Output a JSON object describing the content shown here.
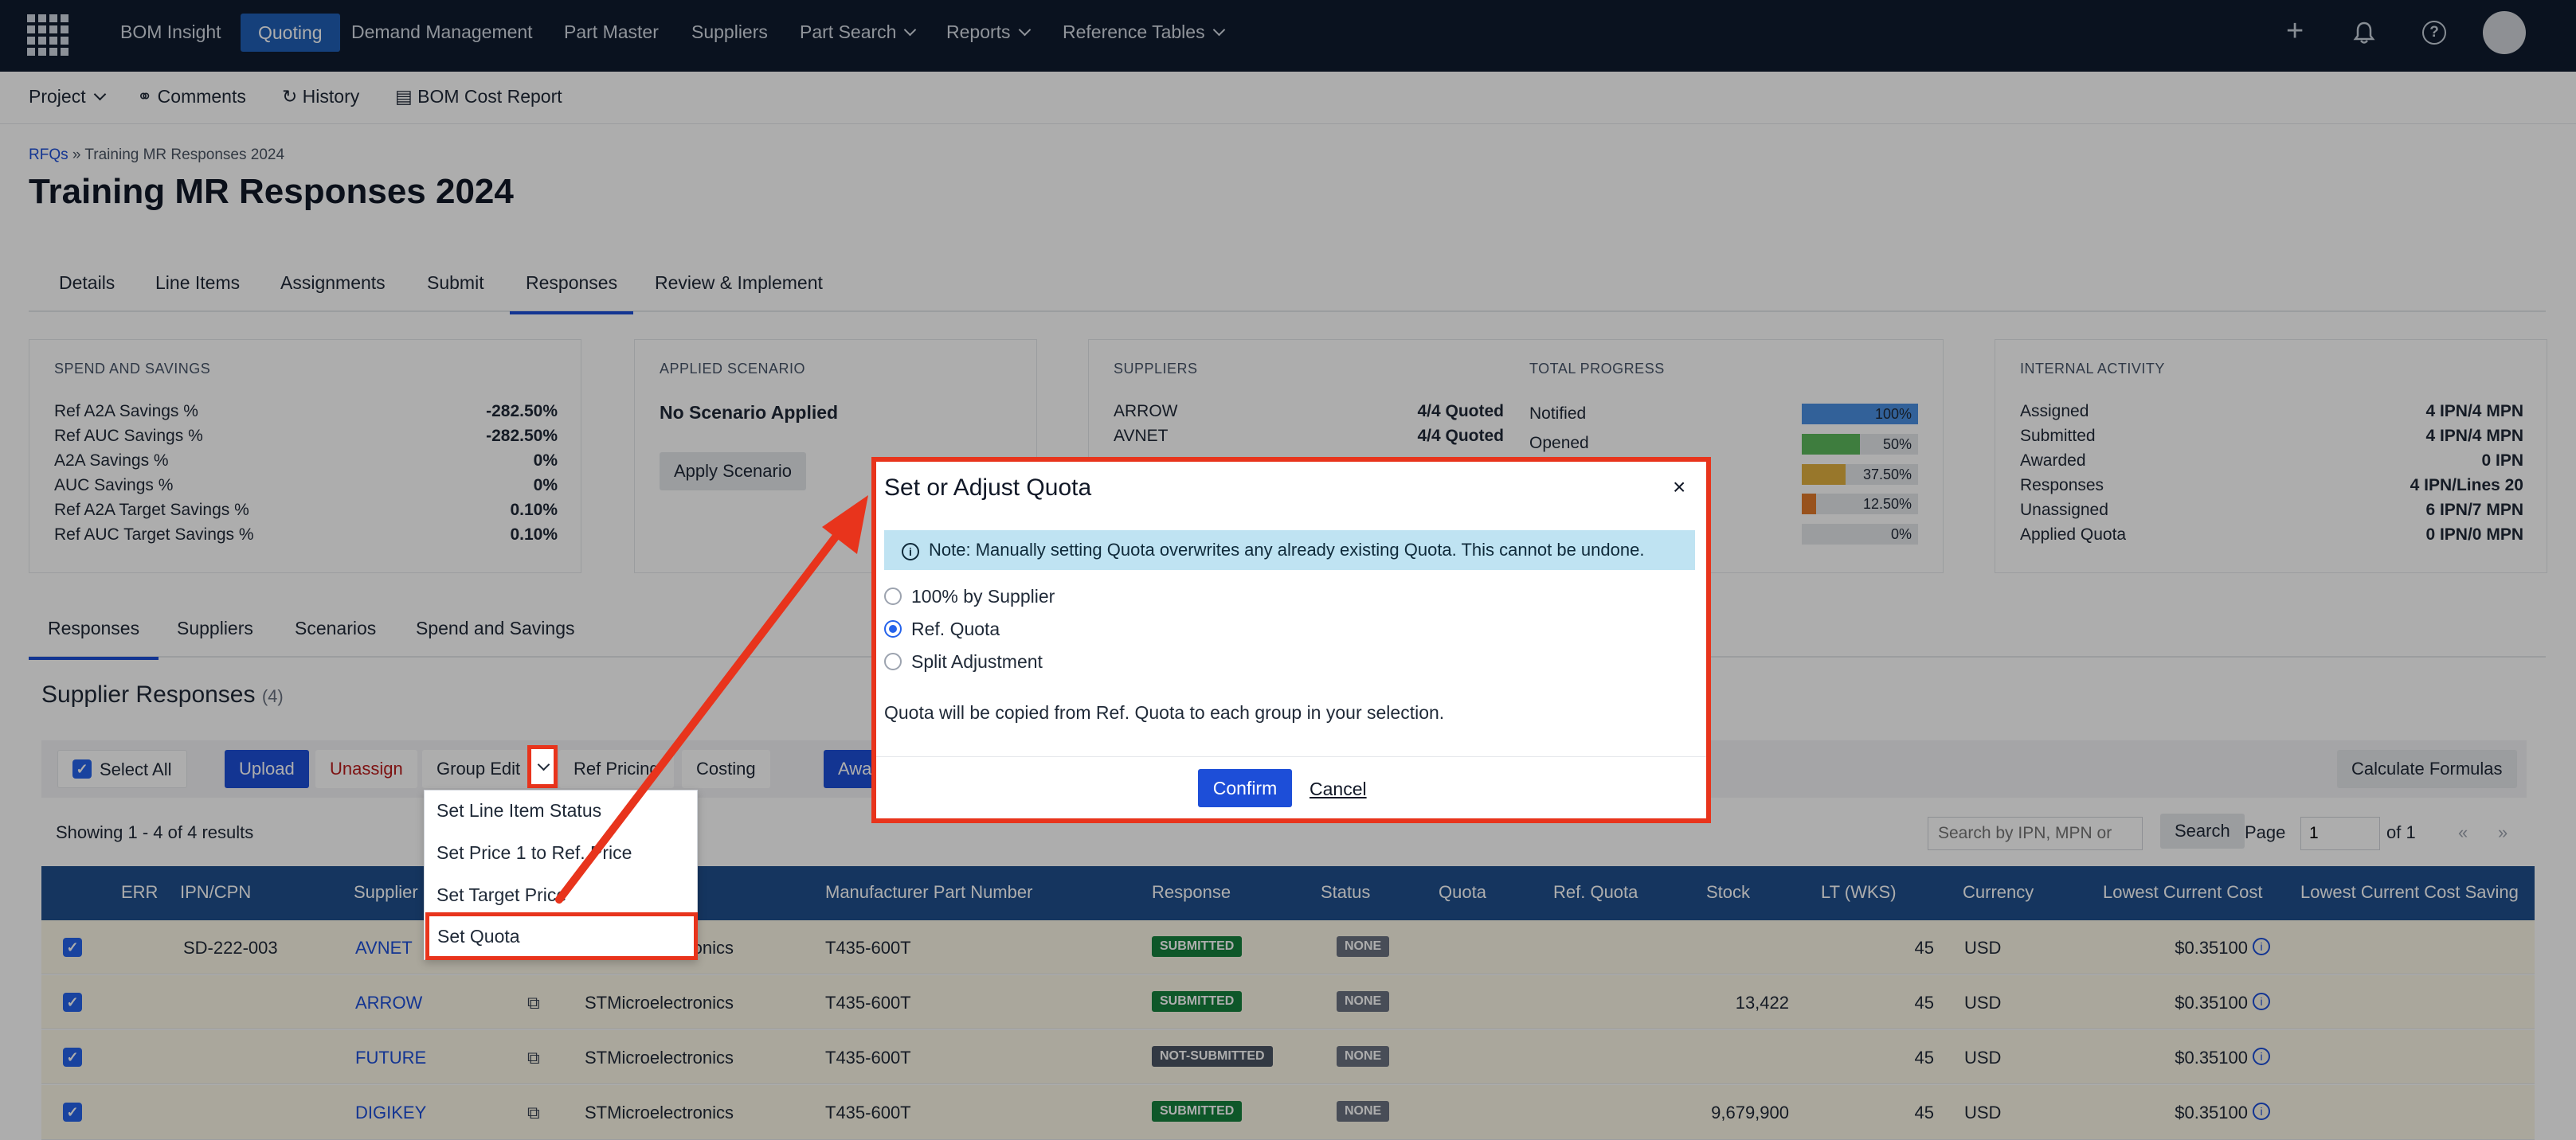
{
  "nav": {
    "items": [
      "BOM Insight",
      "Quoting",
      "Demand Management",
      "Part Master",
      "Suppliers",
      "Part Search",
      "Reports",
      "Reference Tables"
    ],
    "active": "Quoting",
    "plus": "+",
    "help": "?"
  },
  "subbar": {
    "project": "Project",
    "comments": "Comments",
    "history": "History",
    "bom_cost_report": "BOM Cost Report"
  },
  "breadcrumb": {
    "root": "RFQs",
    "sep": " » ",
    "current": "Training MR Responses 2024"
  },
  "page_title": "Training MR Responses 2024",
  "tabs": [
    "Details",
    "Line Items",
    "Assignments",
    "Submit",
    "Responses",
    "Review & Implement"
  ],
  "spend": {
    "title": "SPEND AND SAVINGS",
    "rows": [
      {
        "label": "Ref A2A Savings %",
        "value": "-282.50%"
      },
      {
        "label": "Ref AUC Savings %",
        "value": "-282.50%"
      },
      {
        "label": "A2A Savings %",
        "value": "0%"
      },
      {
        "label": "AUC Savings %",
        "value": "0%"
      },
      {
        "label": "Ref A2A Target Savings %",
        "value": "0.10%"
      },
      {
        "label": "Ref AUC Target Savings %",
        "value": "0.10%"
      }
    ]
  },
  "scenario": {
    "title": "APPLIED SCENARIO",
    "value": "No Scenario Applied",
    "button": "Apply Scenario"
  },
  "suppliers_card": {
    "title": "SUPPLIERS",
    "rows": [
      {
        "label": "ARROW",
        "value": "4/4 Quoted"
      },
      {
        "label": "AVNET",
        "value": "4/4 Quoted"
      }
    ]
  },
  "progress": {
    "title": "TOTAL PROGRESS",
    "rows": [
      {
        "label": "Notified",
        "pct": "100%",
        "fill": 100,
        "color": "#4a90e2"
      },
      {
        "label": "Opened",
        "pct": "50%",
        "fill": 50,
        "color": "#5cb85c"
      },
      {
        "label": "",
        "pct": "37.50%",
        "fill": 37.5,
        "color": "#e0b040"
      },
      {
        "label": "",
        "pct": "12.50%",
        "fill": 12.5,
        "color": "#e07a2c"
      },
      {
        "label": "",
        "pct": "0%",
        "fill": 0,
        "color": "#d98cc4"
      }
    ]
  },
  "internal": {
    "title": "INTERNAL ACTIVITY",
    "rows": [
      {
        "label": "Assigned",
        "value": "4 IPN/4 MPN"
      },
      {
        "label": "Submitted",
        "value": "4 IPN/4 MPN"
      },
      {
        "label": "Awarded",
        "value": "0 IPN"
      },
      {
        "label": "Responses",
        "value": "4 IPN/Lines 20"
      },
      {
        "label": "Unassigned",
        "value": "6 IPN/7 MPN"
      },
      {
        "label": "Applied Quota",
        "value": "0 IPN/0 MPN"
      }
    ]
  },
  "lower_tabs": [
    "Responses",
    "Suppliers",
    "Scenarios",
    "Spend and Savings"
  ],
  "section": {
    "title": "Supplier Responses",
    "count": "(4)"
  },
  "toolbar": {
    "select_all": "Select All",
    "upload": "Upload",
    "unassign": "Unassign",
    "group_edit": "Group Edit",
    "ref_pricing": "Ref Pricing",
    "costing": "Costing",
    "award": "Awa",
    "calculate": "Calculate Formulas"
  },
  "results": {
    "showing": "Showing 1 - 4 of 4 results",
    "search_placeholder": "Search by IPN, MPN or",
    "search": "Search",
    "page_label": "Page",
    "page": "1",
    "of": "of 1",
    "prev": "«",
    "next": "»"
  },
  "table": {
    "headers": [
      "ERR",
      "IPN/CPN",
      "Supplier",
      "Manufacturer Part Number",
      "Response",
      "Status",
      "Quota",
      "Ref. Quota",
      "Stock",
      "LT (WKS)",
      "Currency",
      "Lowest Current Cost",
      "Lowest Current Cost Saving"
    ],
    "rows": [
      {
        "ipn": "SD-222-003",
        "supplier": "AVNET",
        "mfr": "STMicroelectronics",
        "mpn": "T435-600T",
        "response": "SUBMITTED",
        "status": "NONE",
        "stock": "",
        "lt": "45",
        "currency": "USD",
        "cost": "$0.35100"
      },
      {
        "ipn": "",
        "supplier": "ARROW",
        "mfr": "STMicroelectronics",
        "mpn": "T435-600T",
        "response": "SUBMITTED",
        "status": "NONE",
        "stock": "13,422",
        "lt": "45",
        "currency": "USD",
        "cost": "$0.35100"
      },
      {
        "ipn": "",
        "supplier": "FUTURE",
        "mfr": "STMicroelectronics",
        "mpn": "T435-600T",
        "response": "NOT-SUBMITTED",
        "status": "NONE",
        "stock": "",
        "lt": "45",
        "currency": "USD",
        "cost": "$0.35100"
      },
      {
        "ipn": "",
        "supplier": "DIGIKEY",
        "mfr": "STMicroelectronics",
        "mpn": "T435-600T",
        "response": "SUBMITTED",
        "status": "NONE",
        "stock": "9,679,900",
        "lt": "45",
        "currency": "USD",
        "cost": "$0.35100"
      }
    ]
  },
  "dropdown": [
    "Set Line Item Status",
    "Set Price 1 to Ref. Price",
    "Set Target Price",
    "Set Quota"
  ],
  "modal": {
    "title": "Set or Adjust Quota",
    "close": "×",
    "note": "Note: Manually setting Quota overwrites any already existing Quota. This cannot be undone.",
    "options": [
      {
        "label": "100% by Supplier",
        "selected": false
      },
      {
        "label": "Ref. Quota",
        "selected": true
      },
      {
        "label": "Split Adjustment",
        "selected": false
      }
    ],
    "description": "Quota will be copied from Ref. Quota to each group in your selection.",
    "confirm": "Confirm",
    "cancel": "Cancel"
  }
}
